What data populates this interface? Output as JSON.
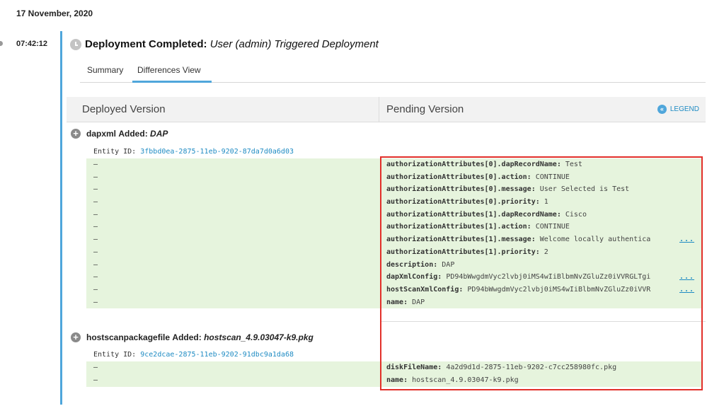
{
  "date": "17 November, 2020",
  "time": "07:42:12",
  "deployment": {
    "status": "Deployment Completed:",
    "description": "User (admin) Triggered Deployment"
  },
  "tabs": [
    {
      "label": "Summary",
      "active": false
    },
    {
      "label": "Differences View",
      "active": true
    }
  ],
  "columns": {
    "deployed": "Deployed Version",
    "pending": "Pending Version",
    "legend": "LEGEND"
  },
  "sections": [
    {
      "name": "dapxml",
      "added_label": "Added:",
      "type": "DAP",
      "entity_label": "Entity ID:",
      "entity_id": "3fbbd0ea-2875-11eb-9202-87da7d0a6d03",
      "rows": [
        {
          "dash": "–",
          "key": "authorizationAttributes[0].dapRecordName:",
          "value": "Test",
          "more": ""
        },
        {
          "dash": "–",
          "key": "authorizationAttributes[0].action:",
          "value": "CONTINUE",
          "more": ""
        },
        {
          "dash": "–",
          "key": "authorizationAttributes[0].message:",
          "value": "User Selected is Test",
          "more": ""
        },
        {
          "dash": "–",
          "key": "authorizationAttributes[0].priority:",
          "value": "1",
          "more": ""
        },
        {
          "dash": "–",
          "key": "authorizationAttributes[1].dapRecordName:",
          "value": "Cisco",
          "more": ""
        },
        {
          "dash": "–",
          "key": "authorizationAttributes[1].action:",
          "value": "CONTINUE",
          "more": ""
        },
        {
          "dash": "–",
          "key": "authorizationAttributes[1].message:",
          "value": "Welcome locally authentica",
          "more": "..."
        },
        {
          "dash": "–",
          "key": "authorizationAttributes[1].priority:",
          "value": "2",
          "more": ""
        },
        {
          "dash": "–",
          "key": "description:",
          "value": "DAP",
          "more": ""
        },
        {
          "dash": "–",
          "key": "dapXmlConfig:",
          "value": "PD94bWwgdmVyc2lvbj0iMS4wIiBlbmNvZGluZz0iVVRGLTgi",
          "more": "..."
        },
        {
          "dash": "–",
          "key": "hostScanXmlConfig:",
          "value": "PD94bWwgdmVyc2lvbj0iMS4wIiBlbmNvZGluZz0iVVR",
          "more": "..."
        },
        {
          "dash": "–",
          "key": "name:",
          "value": "DAP",
          "more": ""
        }
      ]
    },
    {
      "name": "hostscanpackagefile",
      "added_label": "Added:",
      "type": "hostscan_4.9.03047-k9.pkg",
      "entity_label": "Entity ID:",
      "entity_id": "9ce2dcae-2875-11eb-9202-91dbc9a1da68",
      "rows": [
        {
          "dash": "–",
          "key": "diskFileName:",
          "value": "4a2d9d1d-2875-11eb-9202-c7cc258980fc.pkg",
          "more": ""
        },
        {
          "dash": "–",
          "key": "name:",
          "value": "hostscan_4.9.03047-k9.pkg",
          "more": ""
        }
      ]
    }
  ],
  "colors": {
    "accent": "#4fa6db",
    "diff_added_bg": "#e6f4dd",
    "highlight": "#e2302a"
  },
  "icons": {
    "clock": "clock-icon",
    "plus": "plus-circle-icon",
    "legend": "double-chevron-left-icon"
  }
}
